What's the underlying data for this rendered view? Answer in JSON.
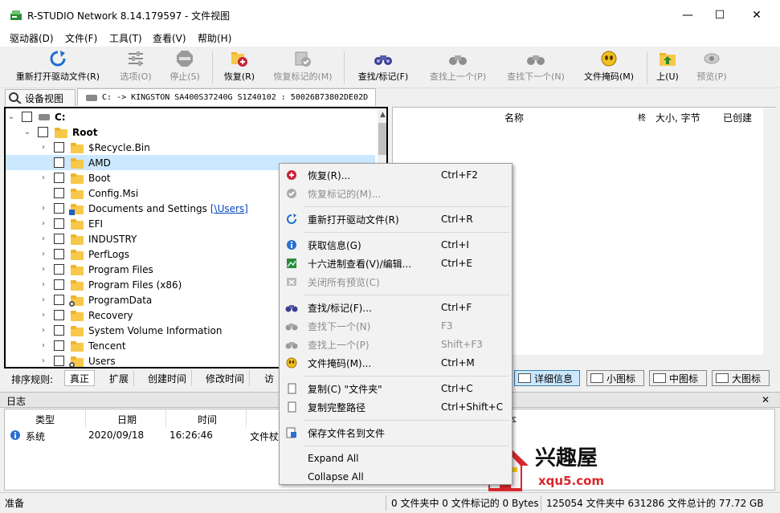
{
  "window": {
    "title": "R-STUDIO Network 8.14.179597 - 文件视图",
    "minimize": "—",
    "maximize": "☐",
    "close": "✕"
  },
  "menubar": [
    "驱动器(D)",
    "文件(F)",
    "工具(T)",
    "查看(V)",
    "帮助(H)"
  ],
  "toolbar": [
    {
      "label": "重新打开驱动文件(R)",
      "icon": "reopen-icon",
      "enabled": true
    },
    {
      "label": "选项(O)",
      "icon": "options-icon",
      "enabled": false
    },
    {
      "label": "停止(S)",
      "icon": "stop-icon",
      "enabled": false
    },
    {
      "label": "恢复(R)",
      "icon": "recover-icon",
      "enabled": true
    },
    {
      "label": "恢复标记的(M)",
      "icon": "recover-marked-icon",
      "enabled": false
    },
    {
      "label": "查找/标记(F)",
      "icon": "binoculars-icon",
      "enabled": true
    },
    {
      "label": "查找上一个(P)",
      "icon": "find-prev-icon",
      "enabled": false
    },
    {
      "label": "查找下一个(N)",
      "icon": "find-next-icon",
      "enabled": false
    },
    {
      "label": "文件掩码(M)",
      "icon": "file-mask-icon",
      "enabled": true
    },
    {
      "label": "上(U)",
      "icon": "folder-up-icon",
      "enabled": true
    },
    {
      "label": "预览(P)",
      "icon": "preview-icon",
      "enabled": false
    }
  ],
  "tabs": {
    "device": "设备视图",
    "file": "C: -> KINGSTON SA400S37240G S1Z40102 : 50026B73802DE02D"
  },
  "tree": {
    "drive": "C:",
    "root": "Root",
    "items": [
      {
        "label": "$Recycle.Bin",
        "expand": true,
        "badge": ""
      },
      {
        "label": "AMD",
        "expand": false,
        "badge": "",
        "selected": true
      },
      {
        "label": "Boot",
        "expand": true,
        "badge": ""
      },
      {
        "label": "Config.Msi",
        "expand": false,
        "badge": ""
      },
      {
        "label": "Documents and Settings",
        "expand": true,
        "badge": "link",
        "link": "[\\Users]"
      },
      {
        "label": "EFI",
        "expand": true,
        "badge": ""
      },
      {
        "label": "INDUSTRY",
        "expand": true,
        "badge": ""
      },
      {
        "label": "PerfLogs",
        "expand": true,
        "badge": ""
      },
      {
        "label": "Program Files",
        "expand": true,
        "badge": ""
      },
      {
        "label": "Program Files (x86)",
        "expand": true,
        "badge": ""
      },
      {
        "label": "ProgramData",
        "expand": true,
        "badge": "gear"
      },
      {
        "label": "Recovery",
        "expand": true,
        "badge": ""
      },
      {
        "label": "System Volume Information",
        "expand": true,
        "badge": ""
      },
      {
        "label": "Tencent",
        "expand": true,
        "badge": ""
      },
      {
        "label": "Users",
        "expand": true,
        "badge": "gear"
      }
    ]
  },
  "filelist": {
    "cols": [
      "名称",
      "柊",
      "大小, 字节",
      "已创建"
    ]
  },
  "sortbar": {
    "label": "排序规则:",
    "tabs": [
      "真正",
      "扩展",
      "创建时间",
      "修改时间",
      "访"
    ]
  },
  "views": [
    "详细信息",
    "小图标",
    "中图标",
    "大图标"
  ],
  "log": {
    "title": "日志",
    "close": "✕",
    "cols": [
      "类型",
      "日期",
      "时间",
      "文件杖",
      "本"
    ],
    "row": {
      "type": "系统",
      "date": "2020/09/18",
      "time": "16:26:46",
      "text": "文件杖"
    }
  },
  "status": {
    "ready": "准备",
    "marked": "0 文件夹中 0 文件标记的 0 Bytes",
    "total": "125054 文件夹中 631286 文件总计的 77.72 GB"
  },
  "context_menu": [
    {
      "label": "恢复(R)...",
      "shortcut": "Ctrl+F2",
      "icon": "recover-icon",
      "enabled": true
    },
    {
      "label": "恢复标记的(M)...",
      "shortcut": "",
      "icon": "recover-marked-icon",
      "enabled": false
    },
    {
      "sep": true
    },
    {
      "label": "重新打开驱动文件(R)",
      "shortcut": "Ctrl+R",
      "icon": "reopen-icon",
      "enabled": true
    },
    {
      "sep": true
    },
    {
      "label": "获取信息(G)",
      "shortcut": "Ctrl+I",
      "icon": "info-icon",
      "enabled": true
    },
    {
      "label": "十六进制查看(V)/编辑...",
      "shortcut": "Ctrl+E",
      "icon": "hex-view-icon",
      "enabled": true
    },
    {
      "label": "关闭所有预览(C)",
      "shortcut": "",
      "icon": "close-preview-icon",
      "enabled": false
    },
    {
      "sep": true
    },
    {
      "label": "查找/标记(F)...",
      "shortcut": "Ctrl+F",
      "icon": "binoculars-icon",
      "enabled": true
    },
    {
      "label": "查找下一个(N)",
      "shortcut": "F3",
      "icon": "find-next-icon",
      "enabled": false
    },
    {
      "label": "查找上一个(P)",
      "shortcut": "Shift+F3",
      "icon": "find-prev-icon",
      "enabled": false
    },
    {
      "label": "文件掩码(M)...",
      "shortcut": "Ctrl+M",
      "icon": "file-mask-icon",
      "enabled": true
    },
    {
      "sep": true
    },
    {
      "label": "复制(C) \"文件夹\"",
      "shortcut": "Ctrl+C",
      "icon": "copy-icon",
      "enabled": true
    },
    {
      "label": "复制完整路径",
      "shortcut": "Ctrl+Shift+C",
      "icon": "copy-path-icon",
      "enabled": true
    },
    {
      "sep": true
    },
    {
      "label": "保存文件名到文件",
      "shortcut": "",
      "icon": "save-names-icon",
      "enabled": true
    },
    {
      "sep": true
    },
    {
      "label": "Expand All",
      "shortcut": "",
      "icon": "",
      "enabled": true
    },
    {
      "label": "Collapse All",
      "shortcut": "",
      "icon": "",
      "enabled": true
    }
  ],
  "watermark": {
    "text": "兴趣屋",
    "url": "xqu5.com"
  },
  "colors": {
    "accent": "#0078d7",
    "selection": "#cce8ff",
    "folder": "#f7c84a",
    "disabled": "#8d8d8d",
    "logo_red": "#d8262b"
  }
}
